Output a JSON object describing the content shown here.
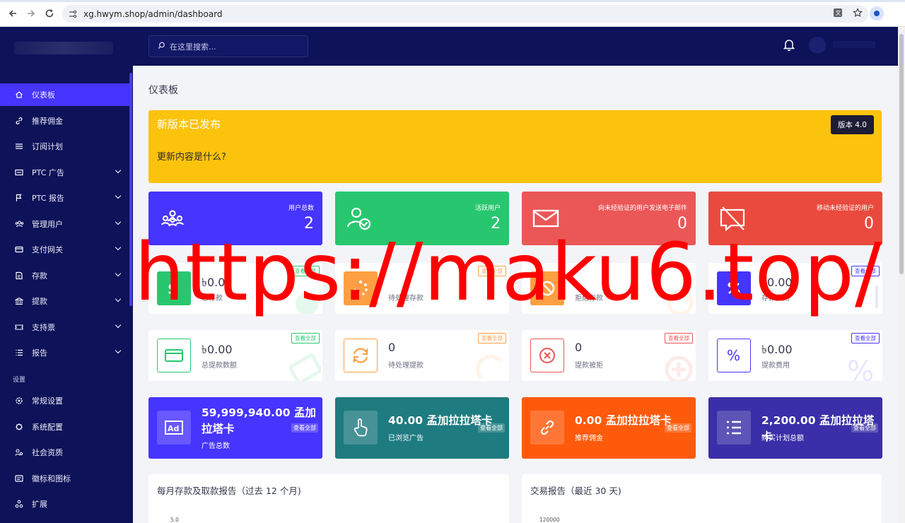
{
  "browser": {
    "url": "xg.hwym.shop/admin/dashboard"
  },
  "sidebar": {
    "items": [
      {
        "label": "仪表板",
        "icon": "home-icon",
        "active": true,
        "expandable": false
      },
      {
        "label": "推荐佣金",
        "icon": "link-icon",
        "active": false,
        "expandable": false
      },
      {
        "label": "订阅计划",
        "icon": "list-icon",
        "active": false,
        "expandable": false
      },
      {
        "label": "PTC 广告",
        "icon": "ad-icon",
        "active": false,
        "expandable": true
      },
      {
        "label": "PTC 报告",
        "icon": "flag-icon",
        "active": false,
        "expandable": true
      },
      {
        "label": "管理用户",
        "icon": "users-icon",
        "active": false,
        "expandable": true
      },
      {
        "label": "支付网关",
        "icon": "card-icon",
        "active": false,
        "expandable": true
      },
      {
        "label": "存款",
        "icon": "deposit-icon",
        "active": false,
        "expandable": true
      },
      {
        "label": "提款",
        "icon": "bank-icon",
        "active": false,
        "expandable": true
      },
      {
        "label": "支持票",
        "icon": "ticket-icon",
        "active": false,
        "expandable": true
      },
      {
        "label": "报告",
        "icon": "report-icon",
        "active": false,
        "expandable": true
      }
    ],
    "settings_heading": "设置",
    "settings_items": [
      {
        "label": "常规设置",
        "icon": "gear-icon"
      },
      {
        "label": "系统配置",
        "icon": "cog-icon"
      },
      {
        "label": "社会资质",
        "icon": "social-icon"
      },
      {
        "label": "徽标和图标",
        "icon": "image-icon"
      },
      {
        "label": "扩展",
        "icon": "extension-icon"
      }
    ]
  },
  "header": {
    "search_placeholder": "在这里搜索..."
  },
  "page": {
    "title": "仪表板"
  },
  "announcement": {
    "title": "新版本已发布",
    "subtitle": "更新内容是什么?",
    "version": "版本 4.0",
    "color": "#fcc30c"
  },
  "stats": [
    {
      "label": "用户总数",
      "value": "2",
      "color": "#4634ff",
      "icon": "users-group-icon"
    },
    {
      "label": "活跃用户",
      "value": "2",
      "color": "#28c76f",
      "icon": "user-check-icon"
    },
    {
      "label": "向未经验证的用户发送电子邮件",
      "value": "0",
      "color": "#eb5757",
      "icon": "envelope-icon"
    },
    {
      "label": "移动未经验证的用户",
      "value": "0",
      "color": "#ea5455",
      "icon": "message-slash-icon"
    }
  ],
  "deposit_cards": [
    {
      "value": "৳0.00",
      "label": "总存款",
      "tag": "查看全部",
      "color": "#28c76f",
      "icon": "money-icon"
    },
    {
      "value": "",
      "label": "待处理存款",
      "tag": "查看全部",
      "color": "#ff9f43",
      "icon": "spinner-icon"
    },
    {
      "value": "",
      "label": "拒绝存款",
      "tag": "",
      "color": "#ff9f43",
      "icon": "ban-icon"
    },
    {
      "value": "৳0.00",
      "label": "存款费用",
      "tag": "查看全部",
      "color": "#4634ff",
      "icon": "percent-icon"
    }
  ],
  "withdraw_cards": [
    {
      "value": "৳0.00",
      "label": "总提款数额",
      "tag": "查看全部",
      "color": "#28c76f",
      "icon": "wallet-icon"
    },
    {
      "value": "0",
      "label": "待处理提款",
      "tag": "查看全部",
      "color": "#ff9f43",
      "icon": "refresh-icon"
    },
    {
      "value": "0",
      "label": "提款被拒",
      "tag": "查看全部",
      "color": "#ea5455",
      "icon": "x-circle-icon"
    },
    {
      "value": "৳0.00",
      "label": "提款费用",
      "tag": "查看全部",
      "color": "#4634ff",
      "icon": "percent-icon"
    }
  ],
  "wide_cards": [
    {
      "value": "59,999,940.00 孟加拉塔卡",
      "label": "广告总数",
      "tag": "查看全部",
      "color": "#4634ff",
      "icon": "ad-icon"
    },
    {
      "value": "40.00 孟加拉拉塔卡",
      "label": "已浏览广告",
      "tag": "查看全部",
      "color": "#1e7b80",
      "icon": "hand-pointer-icon"
    },
    {
      "value": "0.00 孟加拉拉塔卡",
      "label": "推荐佣金",
      "tag": "查看全部",
      "color": "#fe5a0c",
      "icon": "link-icon"
    },
    {
      "value": "2,200.00 孟加拉拉塔卡",
      "label": "购买计划总额",
      "tag": "查看全部",
      "color": "#3a2fa8",
      "icon": "list-icon"
    }
  ],
  "panels": [
    {
      "title": "每月存款及取款报告（过去 12 个月)",
      "tick": "5.0"
    },
    {
      "title": "交易报告（最近 30 天)",
      "tick": "120000"
    }
  ],
  "watermark": "https://maku6.top/"
}
